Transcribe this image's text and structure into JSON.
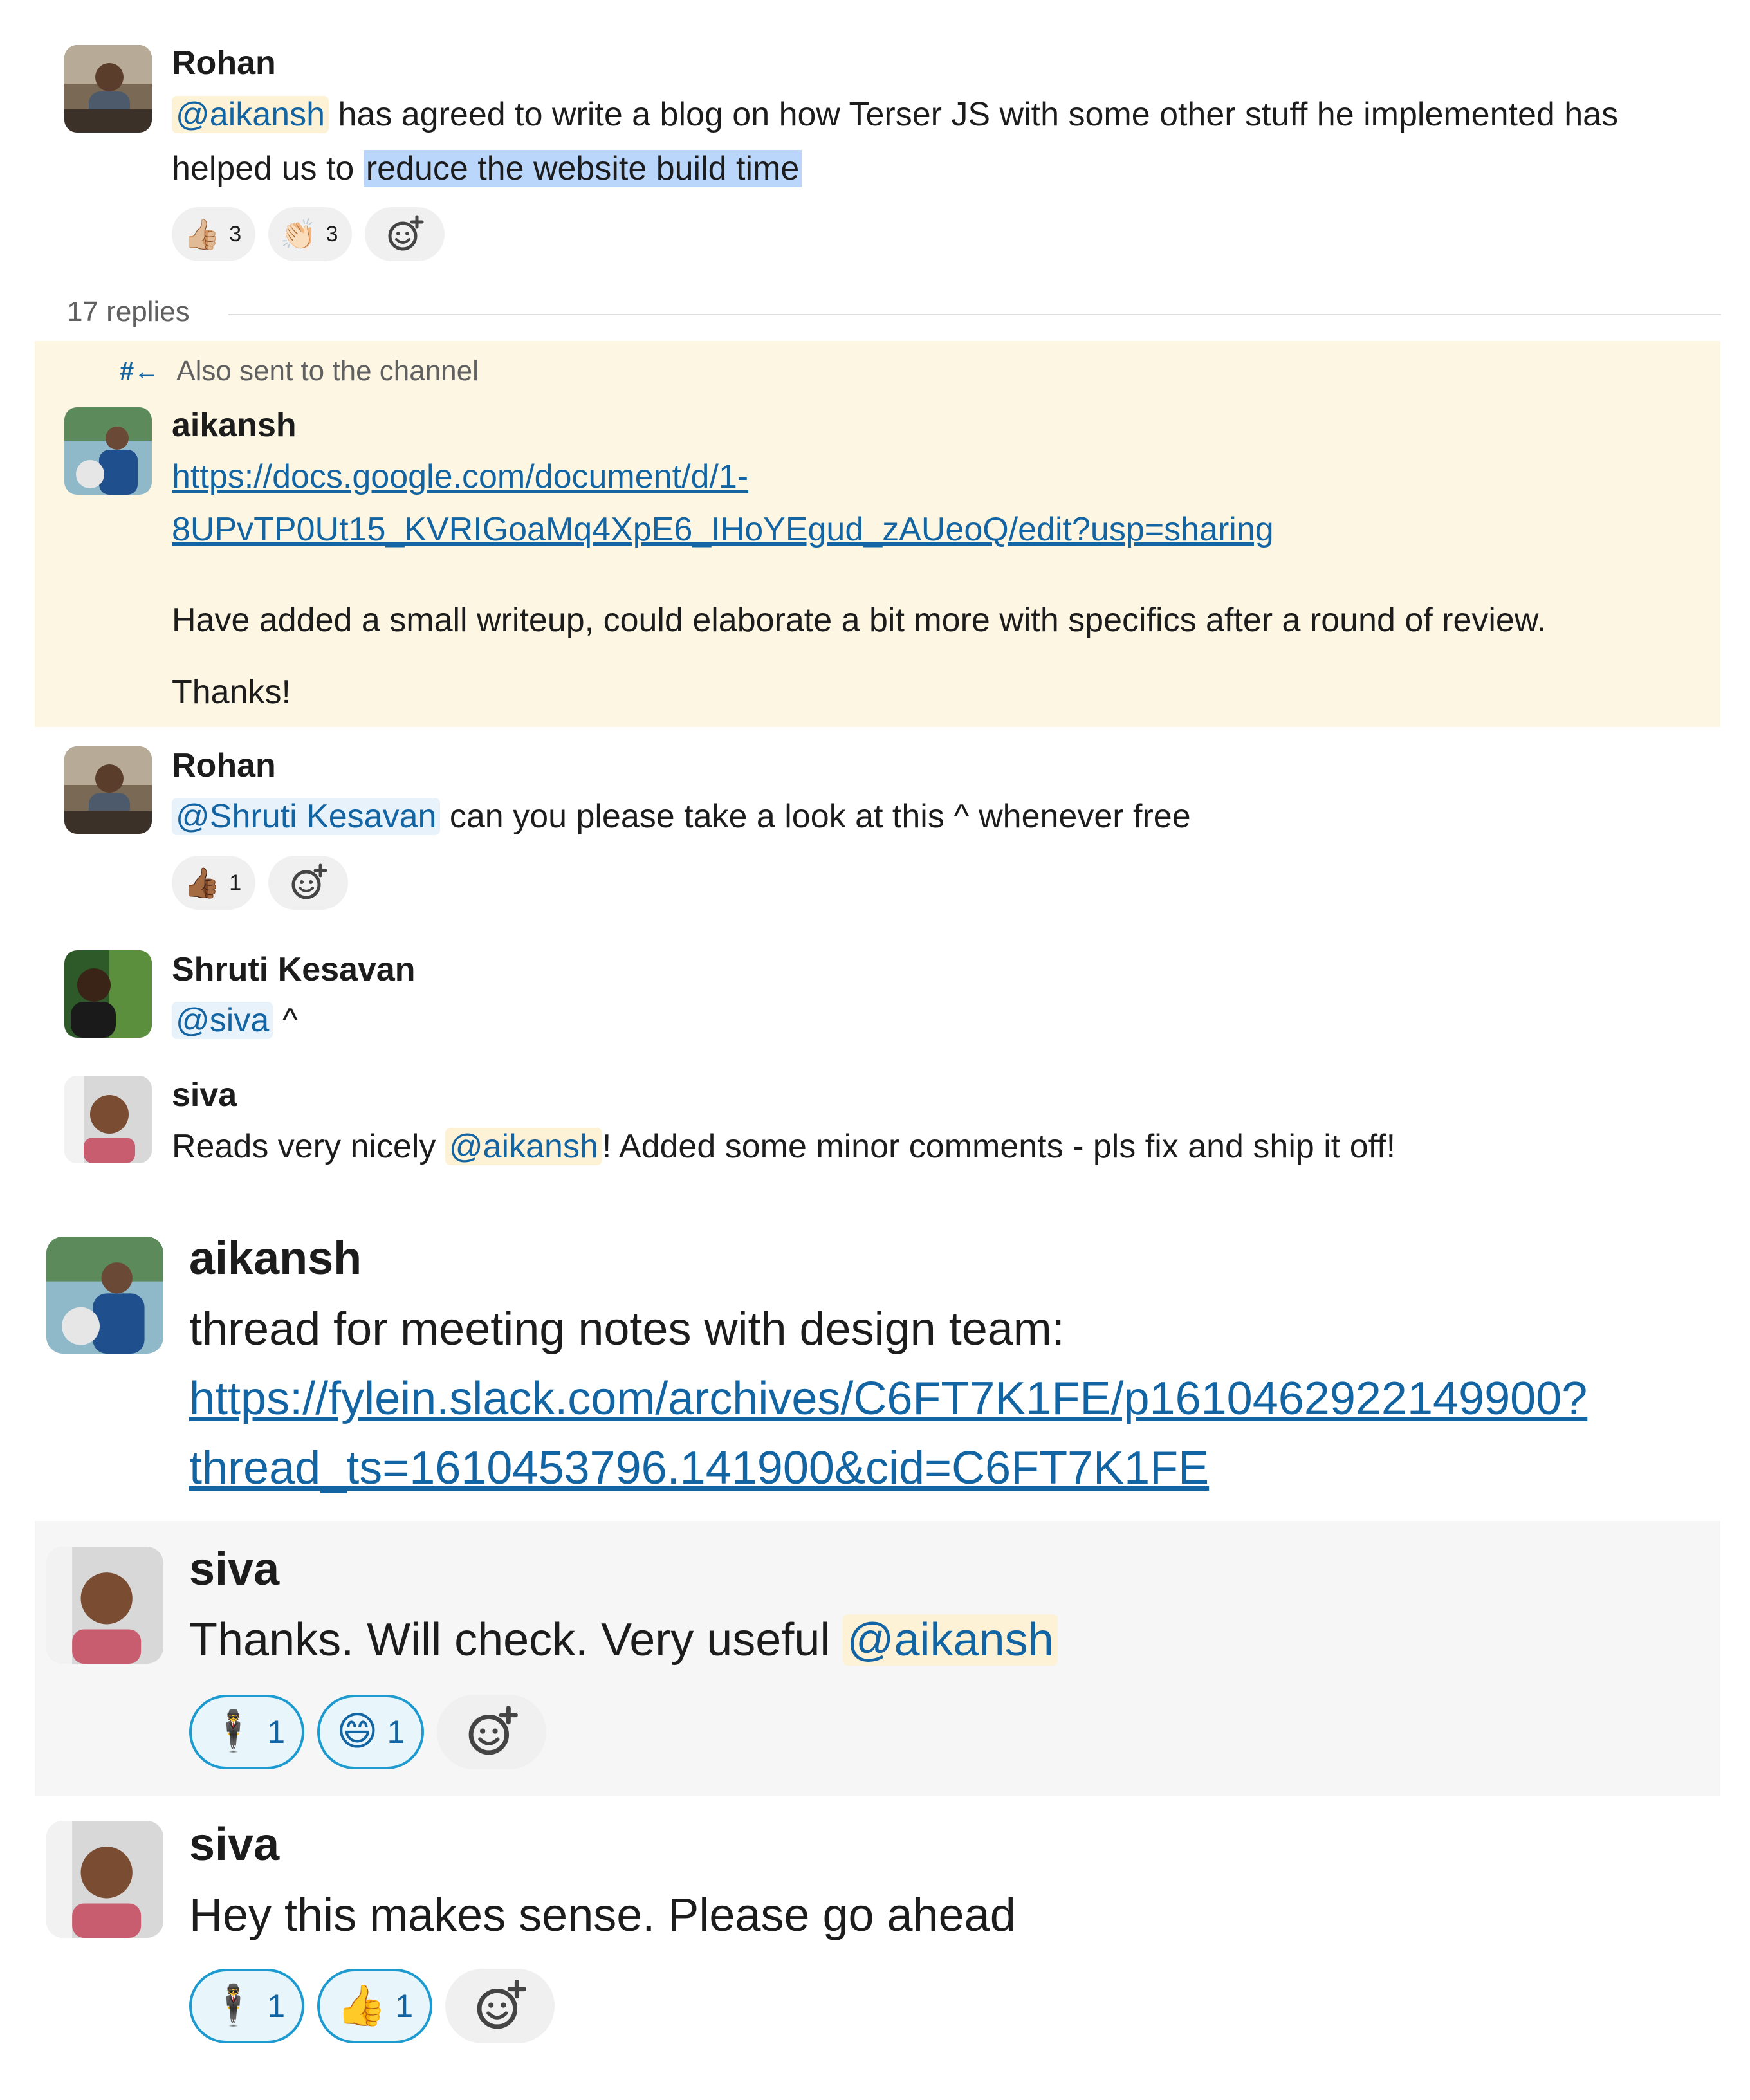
{
  "messages": [
    {
      "sender": "Rohan",
      "mention": "@aikansh",
      "text_line1": " has agreed to write a blog on how Terser JS with some other stuff he implemented has",
      "text_line2_plain": "helped us to ",
      "text_line2_highlight": "reduce the website build time",
      "reactions": [
        {
          "emoji": "👍🏼",
          "count": "3"
        },
        {
          "emoji": "👏🏻",
          "count": "3"
        }
      ]
    }
  ],
  "thread": {
    "replies_label": "17 replies",
    "also_sent_icon": "#←",
    "also_sent_label": "Also sent to the channel",
    "reply1": {
      "sender": "aikansh",
      "link_line1": "https://docs.google.com/document/d/1-",
      "link_line2": "8UPvTP0Ut15_KVRIGoaMq4XpE6_IHoYEgud_zAUeoQ/edit?usp=sharing",
      "para1": "Have added a small writeup, could elaborate a bit more with specifics after a round of review.",
      "para2": "Thanks!"
    },
    "reply2": {
      "sender": "Rohan",
      "mention": "@Shruti Kesavan",
      "text": " can you please take a look at this ^ whenever free",
      "reactions": [
        {
          "emoji": "👍🏾",
          "count": "1"
        }
      ]
    },
    "reply3": {
      "sender": "Shruti Kesavan",
      "mention": "@siva",
      "text": " ^"
    },
    "reply4": {
      "sender": "siva",
      "text_before": "Reads very nicely ",
      "mention": "@aikansh",
      "text_after": "! Added some minor comments - pls fix and ship it off!"
    }
  },
  "channel": {
    "msg1": {
      "sender": "aikansh",
      "text": "thread for meeting notes with design team:",
      "link_line1": "https://fylein.slack.com/archives/C6FT7K1FE/p1610462922149900?",
      "link_line2": "thread_ts=1610453796.141900&cid=C6FT7K1FE"
    },
    "msg2": {
      "sender": "siva",
      "text": "Thanks. Will check. Very useful ",
      "mention": "@aikansh",
      "reactions": [
        {
          "emoji": "🕴",
          "count": "1"
        },
        {
          "emoji": "😄",
          "count": "1"
        }
      ]
    },
    "msg3": {
      "sender": "siva",
      "text": "Hey this makes sense. Please go ahead",
      "reactions": [
        {
          "emoji": "🕴",
          "count": "1"
        },
        {
          "emoji": "👍",
          "count": "1"
        }
      ]
    }
  },
  "icons": {
    "add_reaction": "add-reaction-icon"
  }
}
